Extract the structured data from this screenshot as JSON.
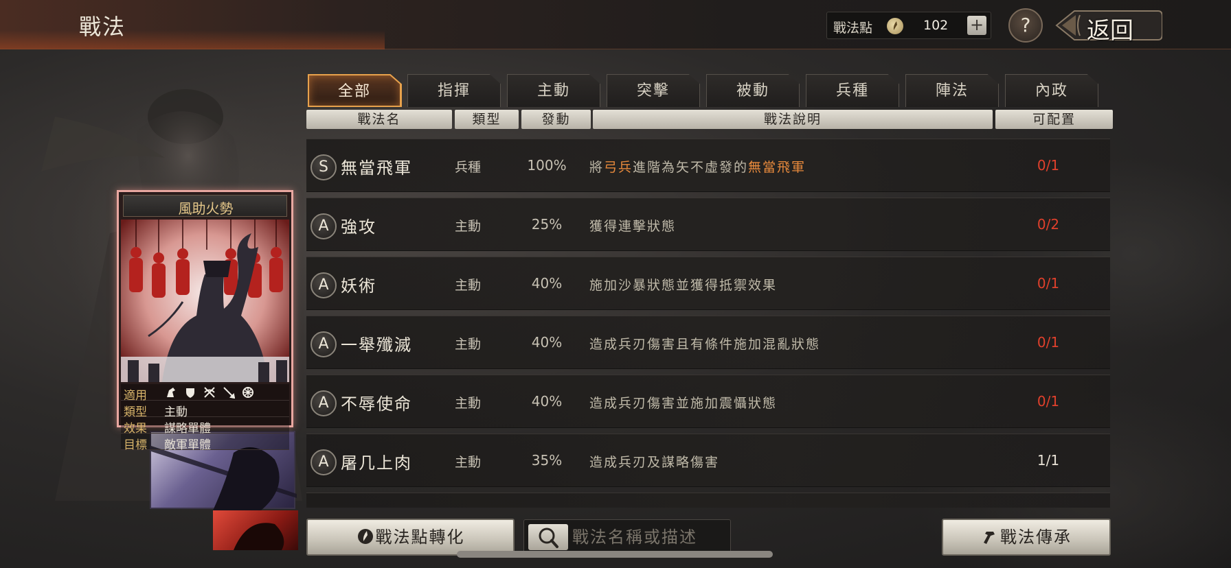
{
  "header": {
    "title": "戰法",
    "points_label": "戰法點",
    "points_value": "102",
    "add_label": "+",
    "help_label": "?",
    "back_label": "返回"
  },
  "card": {
    "title": "風助火勢",
    "rows": [
      {
        "key": "適用",
        "value": ""
      },
      {
        "key": "類型",
        "value": "主動"
      },
      {
        "key": "效果",
        "value": "謀略單體"
      },
      {
        "key": "目標",
        "value": "敵軍單體"
      }
    ],
    "apply_icons": [
      "cavalry-icon",
      "shield-icon",
      "crossbow-icon",
      "spear-icon",
      "wheel-icon"
    ]
  },
  "tabs": [
    "全部",
    "指揮",
    "主動",
    "突擊",
    "被動",
    "兵種",
    "陣法",
    "內政"
  ],
  "active_tab": 0,
  "columns": {
    "name": "戰法名",
    "type": "類型",
    "rate": "發動",
    "desc": "戰法說明",
    "cfg": "可配置"
  },
  "skills": [
    {
      "grade": "S",
      "name": "無當飛軍",
      "type": "兵種",
      "rate": "100%",
      "desc_parts": [
        {
          "text": "將",
          "hl": false
        },
        {
          "text": "弓兵",
          "hl": true
        },
        {
          "text": "進階為矢不虛發的",
          "hl": false
        },
        {
          "text": "無當飛軍",
          "hl": true
        }
      ],
      "cfg": "0/1",
      "cfg_full": true
    },
    {
      "grade": "A",
      "name": "強攻",
      "type": "主動",
      "rate": "25%",
      "desc_parts": [
        {
          "text": "獲得連擊狀態",
          "hl": false
        }
      ],
      "cfg": "0/2",
      "cfg_full": true
    },
    {
      "grade": "A",
      "name": "妖術",
      "type": "主動",
      "rate": "40%",
      "desc_parts": [
        {
          "text": "施加沙暴狀態並獲得抵禦效果",
          "hl": false
        }
      ],
      "cfg": "0/1",
      "cfg_full": true
    },
    {
      "grade": "A",
      "name": "一舉殲滅",
      "type": "主動",
      "rate": "40%",
      "desc_parts": [
        {
          "text": "造成兵刃傷害且有條件施加混亂狀態",
          "hl": false
        }
      ],
      "cfg": "0/1",
      "cfg_full": true
    },
    {
      "grade": "A",
      "name": "不辱使命",
      "type": "主動",
      "rate": "40%",
      "desc_parts": [
        {
          "text": "造成兵刃傷害並施加震懾狀態",
          "hl": false
        }
      ],
      "cfg": "0/1",
      "cfg_full": true
    },
    {
      "grade": "A",
      "name": "屠几上肉",
      "type": "主動",
      "rate": "35%",
      "desc_parts": [
        {
          "text": "造成兵刃及謀略傷害",
          "hl": false
        }
      ],
      "cfg": "1/1",
      "cfg_full": false
    }
  ],
  "bottom": {
    "convert_label": "戰法點轉化",
    "search_placeholder": "戰法名稱或描述",
    "inherit_label": "戰法傳承"
  },
  "colors": {
    "cfg_available": "#e0402c",
    "cfg_used": "#e8e2d6",
    "highlight": "#e88a3c",
    "tab_active_border": "#e8a24c"
  }
}
